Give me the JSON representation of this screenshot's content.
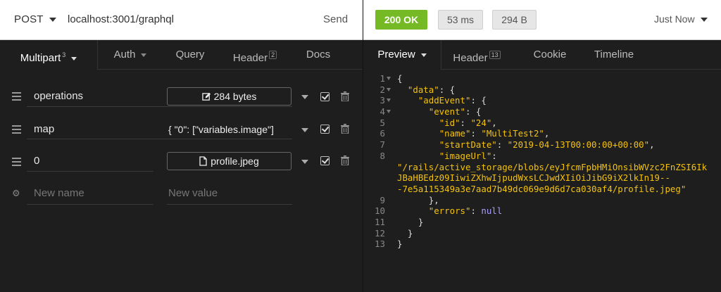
{
  "request": {
    "method": "POST",
    "url": "localhost:3001/graphql",
    "send_label": "Send"
  },
  "response": {
    "status": "200 OK",
    "time": "53 ms",
    "size": "294 B",
    "when": "Just Now"
  },
  "left_tabs": [
    {
      "label": "Multipart",
      "count": "3"
    },
    {
      "label": "Auth"
    },
    {
      "label": "Query"
    },
    {
      "label": "Header",
      "count": "2"
    },
    {
      "label": "Docs"
    }
  ],
  "right_tabs": [
    {
      "label": "Preview"
    },
    {
      "label": "Header",
      "count": "13"
    },
    {
      "label": "Cookie"
    },
    {
      "label": "Timeline"
    }
  ],
  "multipart": {
    "rows": [
      {
        "name": "operations",
        "value": "284 bytes",
        "kind": "edit-file"
      },
      {
        "name": "map",
        "value": "{ \"0\": [\"variables.image\"]",
        "kind": "text"
      },
      {
        "name": "0",
        "value": "profile.jpeg",
        "kind": "file"
      }
    ],
    "new_row": {
      "name_placeholder": "New name",
      "value_placeholder": "New value"
    }
  },
  "code": {
    "line_numbers": [
      "1",
      "2",
      "3",
      "4",
      "5",
      "6",
      "7",
      "8",
      "",
      "",
      "",
      "9",
      "10",
      "11",
      "12",
      "13"
    ],
    "keys": {
      "data": "\"data\"",
      "addEvent": "\"addEvent\"",
      "event": "\"event\"",
      "id": "\"id\"",
      "name": "\"name\"",
      "startDate": "\"startDate\"",
      "imageUrl": "\"imageUrl\"",
      "errors": "\"errors\""
    },
    "values": {
      "id": "\"24\"",
      "name": "\"MultiTest2\"",
      "startDate": "\"2019-04-13T00:00:00+00:00\"",
      "imageUrl_1": "\"/rails/active_storage/blobs/eyJfcmFpbHMiOnsibWVzc2FnZSI6Ik",
      "imageUrl_2": "JBaHBEdz09IiwiZXhwIjpudWxsLCJwdXIiOiJibG9iX2lkIn19--",
      "imageUrl_3": "-7e5a115349a3e7aad7b49dc069e9d6d7ca030af4/profile.jpeg\"",
      "errors": "null"
    }
  },
  "icons": {
    "handle": "drag-handle-icon",
    "check": "checkbox-icon",
    "trash": "trash-icon",
    "gear": "gear-icon",
    "edit": "edit-icon",
    "file": "file-icon"
  },
  "colors": {
    "status_ok": "#75ba24",
    "json_string": "#f4c20d",
    "json_null": "#a89dff"
  }
}
